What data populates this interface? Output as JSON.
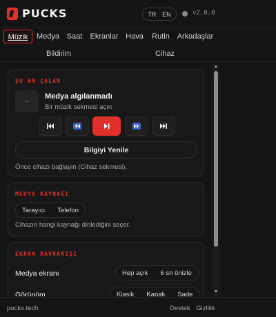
{
  "app": {
    "logo_text": "PUCKS",
    "version": "v2.0.0",
    "languages": [
      "TR",
      "EN"
    ],
    "status_color": "#8a8a8a"
  },
  "tabs": [
    {
      "label": "Müzik",
      "active": true
    },
    {
      "label": "Medya"
    },
    {
      "label": "Saat"
    },
    {
      "label": "Ekranlar"
    },
    {
      "label": "Hava"
    },
    {
      "label": "Rutin"
    },
    {
      "label": "Arkadaşlar"
    },
    {
      "label": "Bildirim"
    },
    {
      "label": "Cihaz"
    }
  ],
  "now_playing": {
    "section_title": "ŞU AN ÇALAN",
    "art_placeholder": "–",
    "title": "Medya algılanmadı",
    "subtitle": "Bir müzik sekmesi açın",
    "controls": [
      "skip-to-start-icon",
      "rewind-icon",
      "play-pause-icon",
      "fast-forward-icon",
      "skip-to-end-icon"
    ],
    "refresh_label": "Bilgiyi Yenile",
    "hint": "Önce cihazı bağlayın (Cihaz sekmesi)."
  },
  "media_source": {
    "section_title": "MEDYA KAYNAĞI",
    "options": [
      "Tarayıcı",
      "Telefon"
    ],
    "hint": "Cihazın hangi kaynağı dinlediğini seçer."
  },
  "screen_behavior": {
    "section_title": "EKRAN DAVRANIŞI",
    "media_screen_label": "Medya ekranı",
    "media_screen_options": [
      "Hep açık",
      "6 sn önizle"
    ],
    "view_label": "Görünüm",
    "view_options": [
      "Klasik",
      "Kapak",
      "Sade"
    ]
  },
  "footer": {
    "site": "pucks.tech",
    "support": "Destek",
    "privacy": "Gizlilik"
  },
  "colors": {
    "accent": "#e0302a",
    "background": "#141414"
  }
}
